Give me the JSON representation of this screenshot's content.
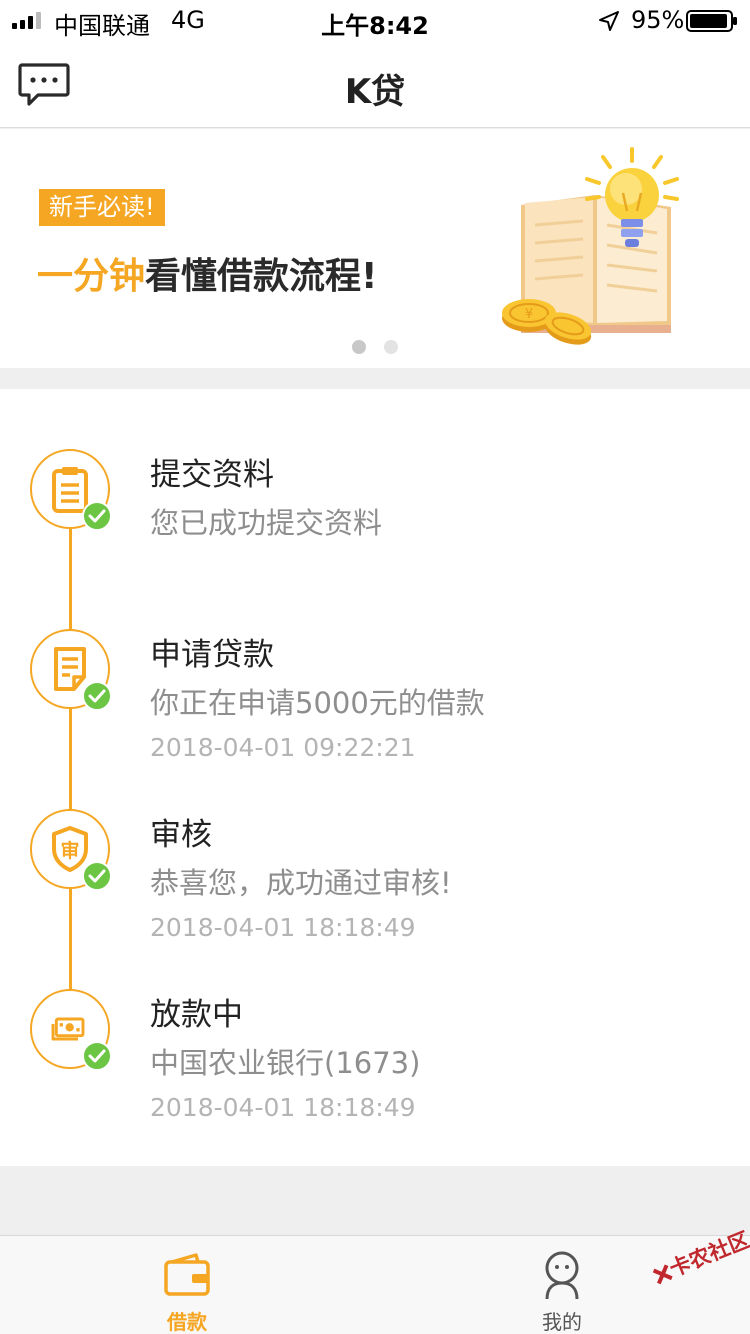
{
  "status_bar": {
    "carrier": "中国联通",
    "network": "4G",
    "time": "上午8:42",
    "battery": "95%",
    "battery_level": 0.95,
    "signal_bars_filled": 3,
    "signal_bars_total": 4
  },
  "nav": {
    "title": "K贷",
    "left_icon": "message-icon"
  },
  "banner": {
    "tag": "新手必读!",
    "headline_accent": "一分钟",
    "headline_main": "看懂借款流程!",
    "page_count": 2,
    "active_page": 1
  },
  "steps": [
    {
      "title": "提交资料",
      "desc": "您已成功提交资料",
      "time": "",
      "icon": "clipboard-icon",
      "done": true
    },
    {
      "title": "申请贷款",
      "desc": "你正在申请5000元的借款",
      "time": "2018-04-01 09:22:21",
      "icon": "document-icon",
      "done": true
    },
    {
      "title": "审核",
      "desc": "恭喜您，成功通过审核!",
      "time": "2018-04-01 18:18:49",
      "icon": "shield-icon",
      "done": true
    },
    {
      "title": "放款中",
      "desc": "中国农业银行(1673)",
      "time": "2018-04-01 18:18:49",
      "icon": "cash-icon",
      "done": true
    }
  ],
  "tabs": [
    {
      "label": "借款",
      "icon": "wallet-icon",
      "active": true
    },
    {
      "label": "我的",
      "icon": "user-icon",
      "active": false
    }
  ],
  "watermark": "卡农社区",
  "colors": {
    "accent": "#f5a623",
    "success": "#6cc644",
    "text_primary": "#222222",
    "text_secondary": "#8e8e8e",
    "text_muted": "#b4b4b4"
  }
}
